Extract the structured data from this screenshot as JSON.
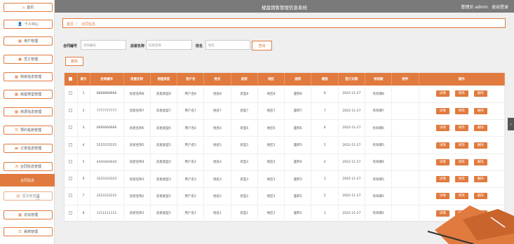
{
  "header": {
    "title": "楼盘销售管理信息系统",
    "role": "管理员 admin",
    "logout": "退出登录"
  },
  "sidebar": {
    "items": [
      {
        "icon": "home-icon",
        "glyph": "⌂",
        "label": "首页"
      },
      {
        "icon": "user-icon",
        "glyph": "👤",
        "label": "个人中心"
      },
      {
        "icon": "grid-icon",
        "glyph": "▦",
        "label": "用户管理"
      },
      {
        "icon": "briefcase-icon",
        "glyph": "▣",
        "label": "员工管理"
      },
      {
        "icon": "grid-icon",
        "glyph": "▦",
        "label": "购房信息管理"
      },
      {
        "icon": "grid-icon",
        "glyph": "▦",
        "label": "房屋类型管理"
      },
      {
        "icon": "grid-icon",
        "glyph": "▦",
        "label": "房源信息管理"
      },
      {
        "icon": "list-icon",
        "glyph": "☰",
        "label": "预约看房管理"
      },
      {
        "icon": "monitor-icon",
        "glyph": "▬",
        "label": "订单信息管理"
      },
      {
        "icon": "pie-icon",
        "glyph": "◔",
        "label": "合同信息管理"
      }
    ],
    "active": "合同信息",
    "after": [
      {
        "icon": "grid-icon",
        "glyph": "▦",
        "label": "留言板管理"
      },
      {
        "icon": "grid-icon",
        "glyph": "▦",
        "label": "论坛管理"
      },
      {
        "icon": "list-icon",
        "glyph": "☰",
        "label": "系统管理"
      }
    ]
  },
  "breadcrumb": {
    "home": "首页",
    "sep": "〉",
    "current": "合同信息"
  },
  "search": {
    "contract_label": "合同编号",
    "contract_placeholder": "合同编号",
    "house_label": "房屋名称",
    "house_placeholder": "房屋名称",
    "name_label": "姓名",
    "name_placeholder": "姓名",
    "query": "查询"
  },
  "delete_button": "删除",
  "table": {
    "columns": [
      "索引",
      "合同编号",
      "房屋名称",
      "房屋类型",
      "用户名",
      "姓名",
      "房型",
      "地区",
      "面积",
      "楼层",
      "签订日期",
      "有效期",
      "附件",
      "操作"
    ],
    "actions": {
      "detail": "详情",
      "edit": "修改",
      "delete": "删除"
    },
    "rows": [
      {
        "idx": "1",
        "no": "8888888888",
        "house": "房屋名称8",
        "type": "房屋类型8",
        "user": "用户名8",
        "name": "姓名8",
        "room": "房型8",
        "area": "地区8",
        "size": "面积8",
        "floor": "8",
        "date": "2022-11-27",
        "valid": "有效期8",
        "file": ""
      },
      {
        "idx": "2",
        "no": "7777777777",
        "house": "房屋名称7",
        "type": "房屋类型7",
        "user": "用户名7",
        "name": "姓名7",
        "room": "房型7",
        "area": "地区7",
        "size": "面积7",
        "floor": "7",
        "date": "2022-11-27",
        "valid": "有效期7",
        "file": ""
      },
      {
        "idx": "3",
        "no": "6666666666",
        "house": "房屋名称6",
        "type": "房屋类型6",
        "user": "用户名6",
        "name": "姓名6",
        "room": "房型6",
        "area": "地区6",
        "size": "面积6",
        "floor": "6",
        "date": "2022-11-27",
        "valid": "有效期6",
        "file": ""
      },
      {
        "idx": "4",
        "no": "5555555555",
        "house": "房屋名称5",
        "type": "房屋类型5",
        "user": "用户名5",
        "name": "姓名5",
        "room": "房型5",
        "area": "地区5",
        "size": "面积5",
        "floor": "5",
        "date": "2022-11-27",
        "valid": "有效期5",
        "file": ""
      },
      {
        "idx": "5",
        "no": "4444444444",
        "house": "房屋名称4",
        "type": "房屋类型4",
        "user": "用户名4",
        "name": "姓名4",
        "room": "房型4",
        "area": "地区4",
        "size": "面积4",
        "floor": "4",
        "date": "2022-11-27",
        "valid": "有效期4",
        "file": ""
      },
      {
        "idx": "6",
        "no": "3333333333",
        "house": "房屋名称3",
        "type": "房屋类型3",
        "user": "用户名3",
        "name": "姓名3",
        "room": "房型3",
        "area": "地区3",
        "size": "面积3",
        "floor": "3",
        "date": "2022-11-27",
        "valid": "有效期3",
        "file": ""
      },
      {
        "idx": "7",
        "no": "2222222222",
        "house": "房屋名称2",
        "type": "房屋类型2",
        "user": "用户名2",
        "name": "姓名2",
        "room": "房型2",
        "area": "地区2",
        "size": "面积2",
        "floor": "2",
        "date": "2022-11-27",
        "valid": "有效期2",
        "file": ""
      },
      {
        "idx": "8",
        "no": "1111111111",
        "house": "房屋名称1",
        "type": "房屋类型1",
        "user": "用户名1",
        "name": "姓名1",
        "room": "房型1",
        "area": "地区1",
        "size": "面积1",
        "floor": "1",
        "date": "2022-11-27",
        "valid": "有效期1",
        "file": ""
      }
    ]
  },
  "colors": {
    "accent": "#e07a3e",
    "topbar": "#7a7a7a"
  }
}
